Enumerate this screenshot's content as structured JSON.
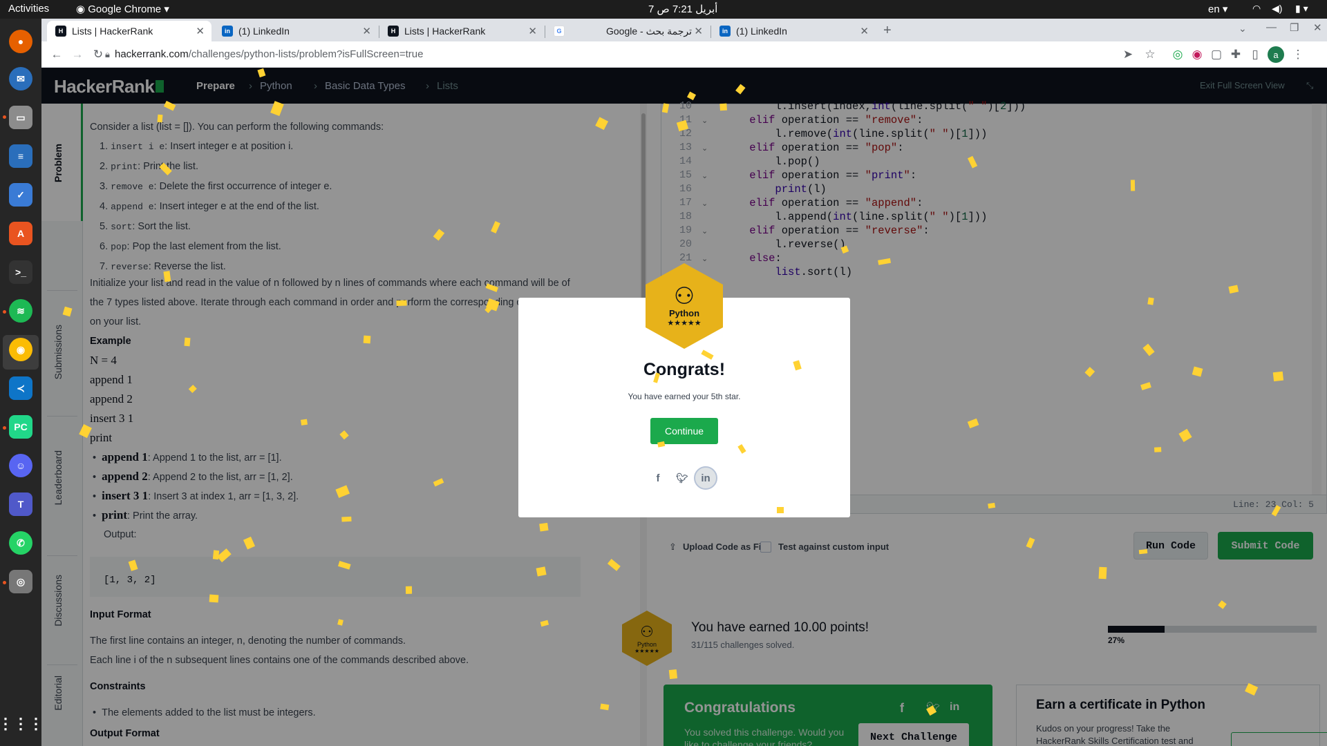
{
  "gnome": {
    "activities": "Activities",
    "app": "Google Chrome",
    "clock": "7 أبريل  7:21 ص",
    "lang": "en"
  },
  "tabs": [
    {
      "title": "Lists | HackerRank",
      "favicon": "hackerrank-icon"
    },
    {
      "title": "(1) LinkedIn",
      "favicon": "linkedin-icon"
    },
    {
      "title": "Lists | HackerRank",
      "favicon": "hackerrank-icon"
    },
    {
      "title": "Google - ترجمة بحث",
      "favicon": "google-icon"
    },
    {
      "title": "(1) LinkedIn",
      "favicon": "linkedin-icon"
    }
  ],
  "address": {
    "host": "hackerrank.com",
    "path": "/challenges/python-lists/problem?isFullScreen=true"
  },
  "nav": {
    "logo": "HackerRank",
    "crumbs": [
      "Prepare",
      "Python",
      "Basic Data Types",
      "Lists"
    ],
    "exit": "Exit Full Screen View"
  },
  "side_tabs": [
    "Problem",
    "Submissions",
    "Leaderboard",
    "Discussions",
    "Editorial"
  ],
  "problem": {
    "intro": "Consider a list (list = []). You can perform the following commands:",
    "commands": [
      {
        "code": "insert i e",
        "text": ": Insert integer e at position i."
      },
      {
        "code": "print",
        "text": ": Print the list."
      },
      {
        "code": "remove e",
        "text": ": Delete the first occurrence of integer e."
      },
      {
        "code": "append e",
        "text": ": Insert integer e at the end of the list."
      },
      {
        "code": "sort",
        "text": ": Sort the list."
      },
      {
        "code": "pop",
        "text": ": Pop the last element from the list."
      },
      {
        "code": "reverse",
        "text": ": Reverse the list."
      }
    ],
    "para1": "Initialize your list and read in the value of n followed by n lines of commands where each command will be of",
    "para2": "the 7 types listed above. Iterate through each command in order and perform the corresponding operation",
    "para3": "on your list.",
    "example_h": "Example",
    "example_lines": [
      "N = 4",
      "append 1",
      "append 2",
      "insert 3 1",
      "print"
    ],
    "bullets": [
      {
        "b": "append 1",
        "t": ": Append 1 to the list, arr = [1]."
      },
      {
        "b": "append 2",
        "t": ": Append 2 to the list, arr = [1, 2]."
      },
      {
        "b": "insert 3 1",
        "t": ": Insert 3 at index 1, arr = [1, 3, 2]."
      },
      {
        "b": "print",
        "t": ": Print the array."
      }
    ],
    "output_label": "Output:",
    "output": "[1, 3, 2]",
    "input_h": "Input Format",
    "input1": "The first line contains an integer, n, denoting the number of commands.",
    "input2": "Each line i of the n subsequent lines contains one of the commands described above.",
    "constraints_h": "Constraints",
    "constraint1": "The elements added to the list must be integers.",
    "output_h": "Output Format"
  },
  "editor": {
    "lines": [
      {
        "n": "10",
        "fold": "",
        "code": "        l.insert(index,int(line.split(\" \")[2]))"
      },
      {
        "n": "11",
        "fold": "v",
        "code": "    elif operation == \"remove\":"
      },
      {
        "n": "12",
        "fold": "",
        "code": "        l.remove(int(line.split(\" \")[1]))"
      },
      {
        "n": "13",
        "fold": "v",
        "code": "    elif operation == \"pop\":"
      },
      {
        "n": "14",
        "fold": "",
        "code": "        l.pop()"
      },
      {
        "n": "15",
        "fold": "v",
        "code": "    elif operation == \"print\":"
      },
      {
        "n": "16",
        "fold": "",
        "code": "        print(l)"
      },
      {
        "n": "17",
        "fold": "v",
        "code": "    elif operation == \"append\":"
      },
      {
        "n": "18",
        "fold": "",
        "code": "        l.append(int(line.split(\" \")[1]))"
      },
      {
        "n": "19",
        "fold": "v",
        "code": "    elif operation == \"reverse\":"
      },
      {
        "n": "20",
        "fold": "",
        "code": "        l.reverse()"
      },
      {
        "n": "21",
        "fold": "v",
        "code": "    else:"
      },
      {
        "n": "22",
        "fold": "",
        "code": "        list.sort(l)"
      },
      {
        "n": "23",
        "fold": "",
        "code": ""
      }
    ],
    "status": "Line: 23 Col: 5"
  },
  "actions": {
    "upload": "Upload Code as File",
    "custom": "Test against custom input",
    "run": "Run Code",
    "submit": "Submit Code"
  },
  "result": {
    "badge_lang": "Python",
    "badge_stars": "★★★★★",
    "points": "You have earned 10.00 points!",
    "solved": "31/115 challenges solved.",
    "progress_pct": 27,
    "progress_label": "27%"
  },
  "congrats_card": {
    "title": "Congratulations",
    "text": "You solved this challenge. Would you like to challenge your friends?",
    "next": "Next Challenge"
  },
  "cert_card": {
    "title": "Earn a certificate in Python",
    "text": "Kudos on your progress! Take the HackerRank Skills Certification test and"
  },
  "modal": {
    "badge_lang": "Python",
    "badge_stars": "★★★★★",
    "title": "Congrats!",
    "message": "You have earned your 5th star.",
    "continue": "Continue"
  },
  "colors": {
    "brand": "#1ba94c",
    "badge": "#e7b21a",
    "confetti": "#ffd233",
    "nav": "#0e141e"
  }
}
